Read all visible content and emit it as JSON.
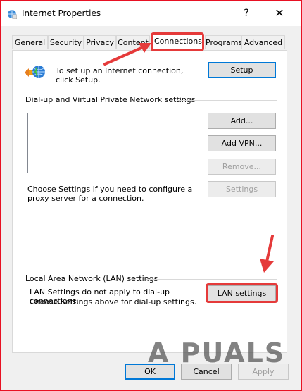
{
  "window": {
    "title": "Internet Properties",
    "help_label": "?",
    "close_label": "✕",
    "icon": "internet-options-icon"
  },
  "tabs": [
    {
      "label": "General"
    },
    {
      "label": "Security"
    },
    {
      "label": "Privacy"
    },
    {
      "label": "Content"
    },
    {
      "label": "Connections"
    },
    {
      "label": "Programs"
    },
    {
      "label": "Advanced"
    }
  ],
  "active_tab": "Connections",
  "setup": {
    "text": "To set up an Internet connection, click Setup.",
    "button": "Setup",
    "icon": "network-globe-icon"
  },
  "dialup": {
    "heading": "Dial-up and Virtual Private Network settings",
    "add_button": "Add...",
    "add_vpn_button": "Add VPN...",
    "remove_button": "Remove...",
    "settings_button": "Settings",
    "proxy_text": "Choose Settings if you need to configure a proxy server for a connection."
  },
  "lan": {
    "heading": "Local Area Network (LAN) settings",
    "text_line1": "LAN Settings do not apply to dial-up connections.",
    "text_line2": "Choose Settings above for dial-up settings.",
    "button": "LAN settings"
  },
  "footer": {
    "ok": "OK",
    "cancel": "Cancel",
    "apply": "Apply"
  },
  "watermark": "A PUALS",
  "colors": {
    "highlight": "#e53a3a",
    "accent": "#0078d7",
    "window_border": "#e81123"
  }
}
